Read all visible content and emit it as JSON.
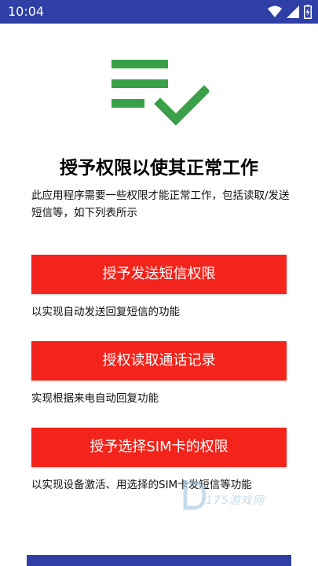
{
  "status_bar": {
    "time": "10:04",
    "icons": [
      "wifi-icon",
      "signal-icon",
      "battery-charging-icon"
    ]
  },
  "colors": {
    "status_bar": "#2f3fa6",
    "button": "#f3241c",
    "check_green": "#3aa047"
  },
  "header": {
    "icon": "checklist-icon",
    "title": "授予权限以使其正常工作",
    "intro": "此应用程序需要一些权限才能正常工作，包括读取/发送短信等，如下列表所示"
  },
  "permissions": [
    {
      "label": "授予发送短信权限",
      "desc": "以实现自动发送回复短信的功能"
    },
    {
      "label": "授权读取通话记录",
      "desc": "实现根据来电自动回复功能"
    },
    {
      "label": "授予选择SIM卡的权限",
      "desc": "以实现设备激活、用选择的SIM卡发短信等功能"
    }
  ],
  "watermark": {
    "text": "175游戏网",
    "icon": "d-logo-icon"
  }
}
